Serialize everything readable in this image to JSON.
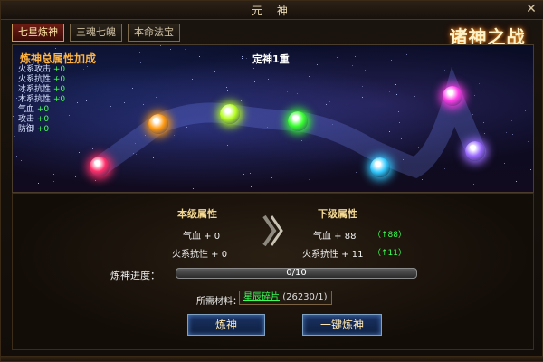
{
  "window": {
    "title": "元 神",
    "close_label": "✕"
  },
  "tabs": [
    {
      "label": "七星炼神",
      "active": true
    },
    {
      "label": "三魂七魄",
      "active": false
    },
    {
      "label": "本命法宝",
      "active": false
    }
  ],
  "logo": {
    "text": "诸神之战",
    "brand_color": "#ffae35"
  },
  "panel": {
    "title": "炼神总属性加成",
    "stage": "定神1重",
    "stats": [
      {
        "name": "火系攻击",
        "value": "+0"
      },
      {
        "name": "火系抗性",
        "value": "+0"
      },
      {
        "name": "冰系抗性",
        "value": "+0"
      },
      {
        "name": "木系抗性",
        "value": "+0"
      },
      {
        "name": "气血",
        "value": "+0"
      },
      {
        "name": "攻击",
        "value": "+0"
      },
      {
        "name": "防御",
        "value": "+0"
      }
    ],
    "orbs": [
      {
        "name": "red-orb",
        "color": "#ff2f6a"
      },
      {
        "name": "orange-orb",
        "color": "#ff9a10"
      },
      {
        "name": "yellow-green-orb",
        "color": "#b6ff21"
      },
      {
        "name": "green-orb",
        "color": "#39ff2f"
      },
      {
        "name": "cyan-orb",
        "color": "#31c9ff"
      },
      {
        "name": "magenta-orb",
        "color": "#ff3fe8"
      },
      {
        "name": "violet-orb",
        "color": "#9b6bff"
      }
    ]
  },
  "attributes": {
    "current_header": "本级属性",
    "next_header": "下级属性",
    "current": [
      {
        "label": "气血 + 0"
      },
      {
        "label": "火系抗性 + 0"
      }
    ],
    "next": [
      {
        "label": "气血 + 88",
        "gain": "（↑88）"
      },
      {
        "label": "火系抗性 + 11",
        "gain": "（↑11）"
      }
    ]
  },
  "progress": {
    "label": "炼神进度：",
    "text": "0/10",
    "current": 0,
    "max": 10,
    "fraction": 0
  },
  "material": {
    "label": "所需材料：",
    "name": "星辰碎片",
    "count": "(26230/1)"
  },
  "buttons": {
    "refine": "炼神",
    "refine_all": "一键炼神"
  },
  "colors": {
    "stat_value": "#44ff5a",
    "header": "#f2d790",
    "panel_title": "#ffb23d"
  }
}
